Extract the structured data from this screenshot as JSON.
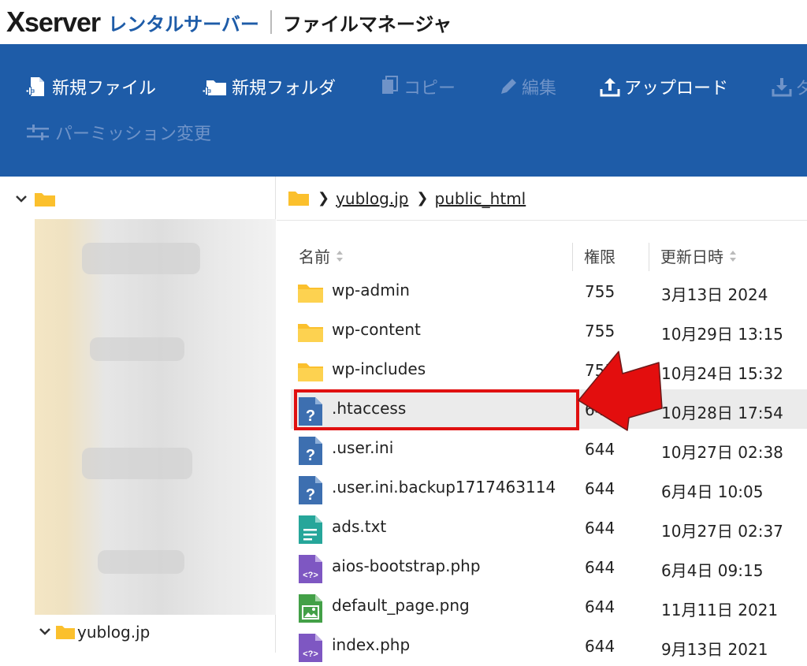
{
  "header": {
    "logo_brand": "server",
    "logo_x": "X",
    "logo_product": "レンタルサーバー",
    "app_title": "ファイルマネージャ"
  },
  "toolbar": {
    "new_file": "新規ファイル",
    "new_folder": "新規フォルダ",
    "copy": "コピー",
    "edit": "編集",
    "upload": "アップロード",
    "download_partial": "ダ",
    "permission": "パーミッション変更"
  },
  "tree": {
    "item_label": "yublog.jp"
  },
  "breadcrumb": {
    "domain": "yublog.jp",
    "folder": "public_html"
  },
  "table": {
    "headers": {
      "name": "名前",
      "perm": "権限",
      "date": "更新日時"
    },
    "rows": [
      {
        "name": "wp-admin",
        "perm": "755",
        "date": "3月13日 2024",
        "type": "folder"
      },
      {
        "name": "wp-content",
        "perm": "755",
        "date": "10月29日 13:15",
        "type": "folder"
      },
      {
        "name": "wp-includes",
        "perm": "755",
        "date": "10月24日 15:32",
        "type": "folder"
      },
      {
        "name": ".htaccess",
        "perm": "644",
        "date": "10月28日 17:54",
        "type": "unknown",
        "selected": true
      },
      {
        "name": ".user.ini",
        "perm": "644",
        "date": "10月27日 02:38",
        "type": "unknown"
      },
      {
        "name": ".user.ini.backup1717463114",
        "perm": "644",
        "date": "6月4日 10:05",
        "type": "unknown"
      },
      {
        "name": "ads.txt",
        "perm": "644",
        "date": "10月27日 02:37",
        "type": "text"
      },
      {
        "name": "aios-bootstrap.php",
        "perm": "644",
        "date": "6月4日 09:15",
        "type": "php"
      },
      {
        "name": "default_page.png",
        "perm": "644",
        "date": "11月11日 2021",
        "type": "image"
      },
      {
        "name": "index.php",
        "perm": "644",
        "date": "9月13日 2021",
        "type": "php"
      }
    ]
  },
  "colors": {
    "toolbar_bg": "#1e5ca8",
    "disabled_text": "#6f93c8",
    "folder": "#fbc02d",
    "unknown_file": "#3d6fb0",
    "text_file": "#26a69a",
    "php_file": "#7e57c2",
    "image_file": "#43a047",
    "highlight": "#e01010"
  },
  "icons": {
    "new_file": "file-plus-icon",
    "new_folder": "folder-plus-icon",
    "copy": "copy-icon",
    "edit": "pencil-icon",
    "upload": "upload-icon",
    "download": "download-icon",
    "permission": "sliders-icon",
    "sort": "sort-icon"
  }
}
